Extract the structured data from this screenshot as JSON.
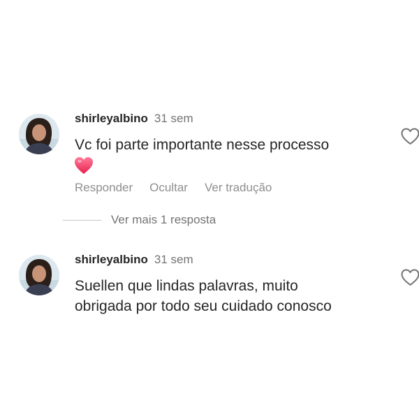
{
  "comments": [
    {
      "username": "shirleyalbino",
      "time": "31 sem",
      "text": "Vc foi parte importante nesse processo",
      "emoji": "heart-emoji",
      "actions": {
        "reply": "Responder",
        "hide": "Ocultar",
        "translate": "Ver tradução"
      }
    },
    {
      "username": "shirleyalbino",
      "time": "31 sem",
      "text_lines": [
        "Suellen que lindas palavras, muito",
        "obrigada por todo seu cuidado conosco"
      ]
    }
  ],
  "more_replies_label": "Ver mais 1 resposta",
  "colors": {
    "text": "#262626",
    "secondary": "#737373",
    "action": "#8e8e8e",
    "heart_emoji": "#f2456d"
  }
}
